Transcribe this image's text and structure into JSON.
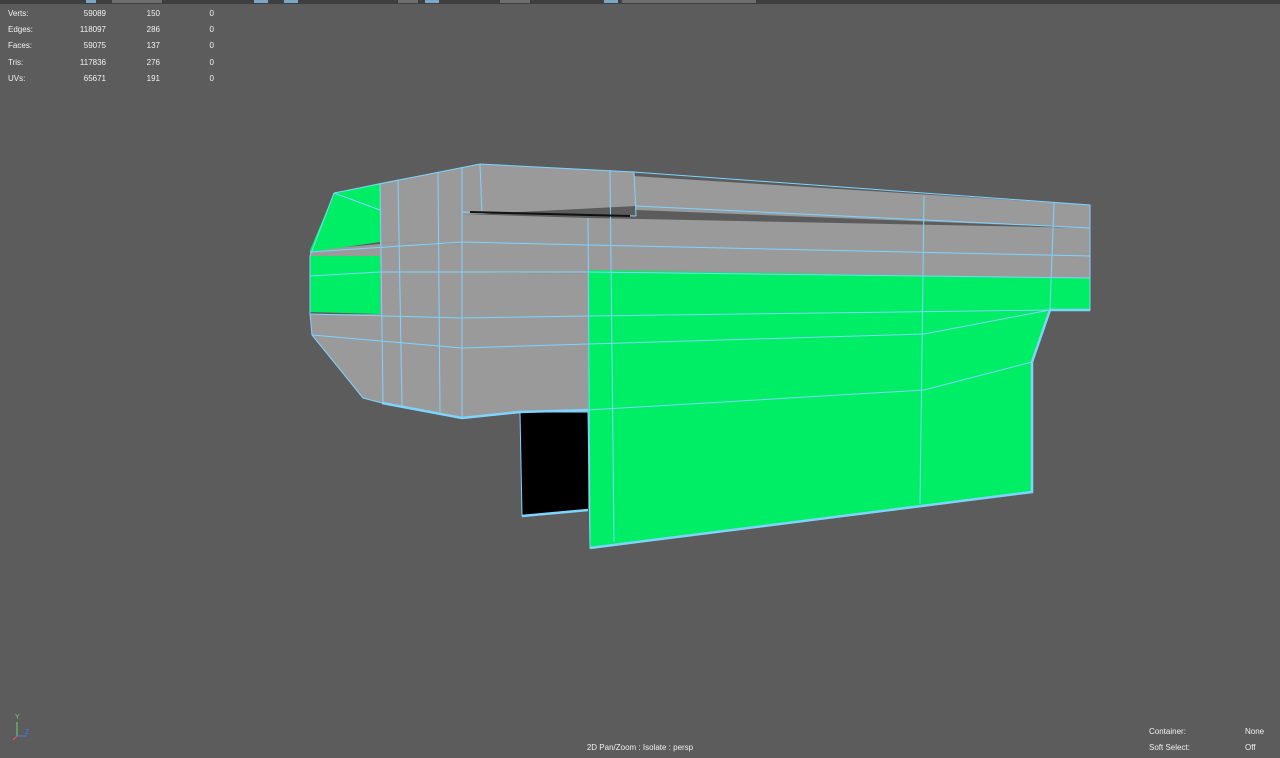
{
  "hud": {
    "rows": [
      {
        "label": "Verts:",
        "total": "59089",
        "selected": "150",
        "extra": "0"
      },
      {
        "label": "Edges:",
        "total": "118097",
        "selected": "286",
        "extra": "0"
      },
      {
        "label": "Faces:",
        "total": "59075",
        "selected": "137",
        "extra": "0"
      },
      {
        "label": "Tris:",
        "total": "117836",
        "selected": "276",
        "extra": "0"
      },
      {
        "label": "UVs:",
        "total": "65671",
        "selected": "191",
        "extra": "0"
      }
    ]
  },
  "viewport": {
    "status_text": "2D Pan/Zoom : Isolate : persp",
    "axis": {
      "y": "Y",
      "z": "Z"
    }
  },
  "info": {
    "container_label": "Container:",
    "container_value": "None",
    "soft_select_label": "Soft Select:",
    "soft_select_value": "Off"
  },
  "colors": {
    "background": "#5c5c5c",
    "selected_face": "#00ee66",
    "wire": "#7fd4ff",
    "shaded_face": "#9a9a9a"
  }
}
